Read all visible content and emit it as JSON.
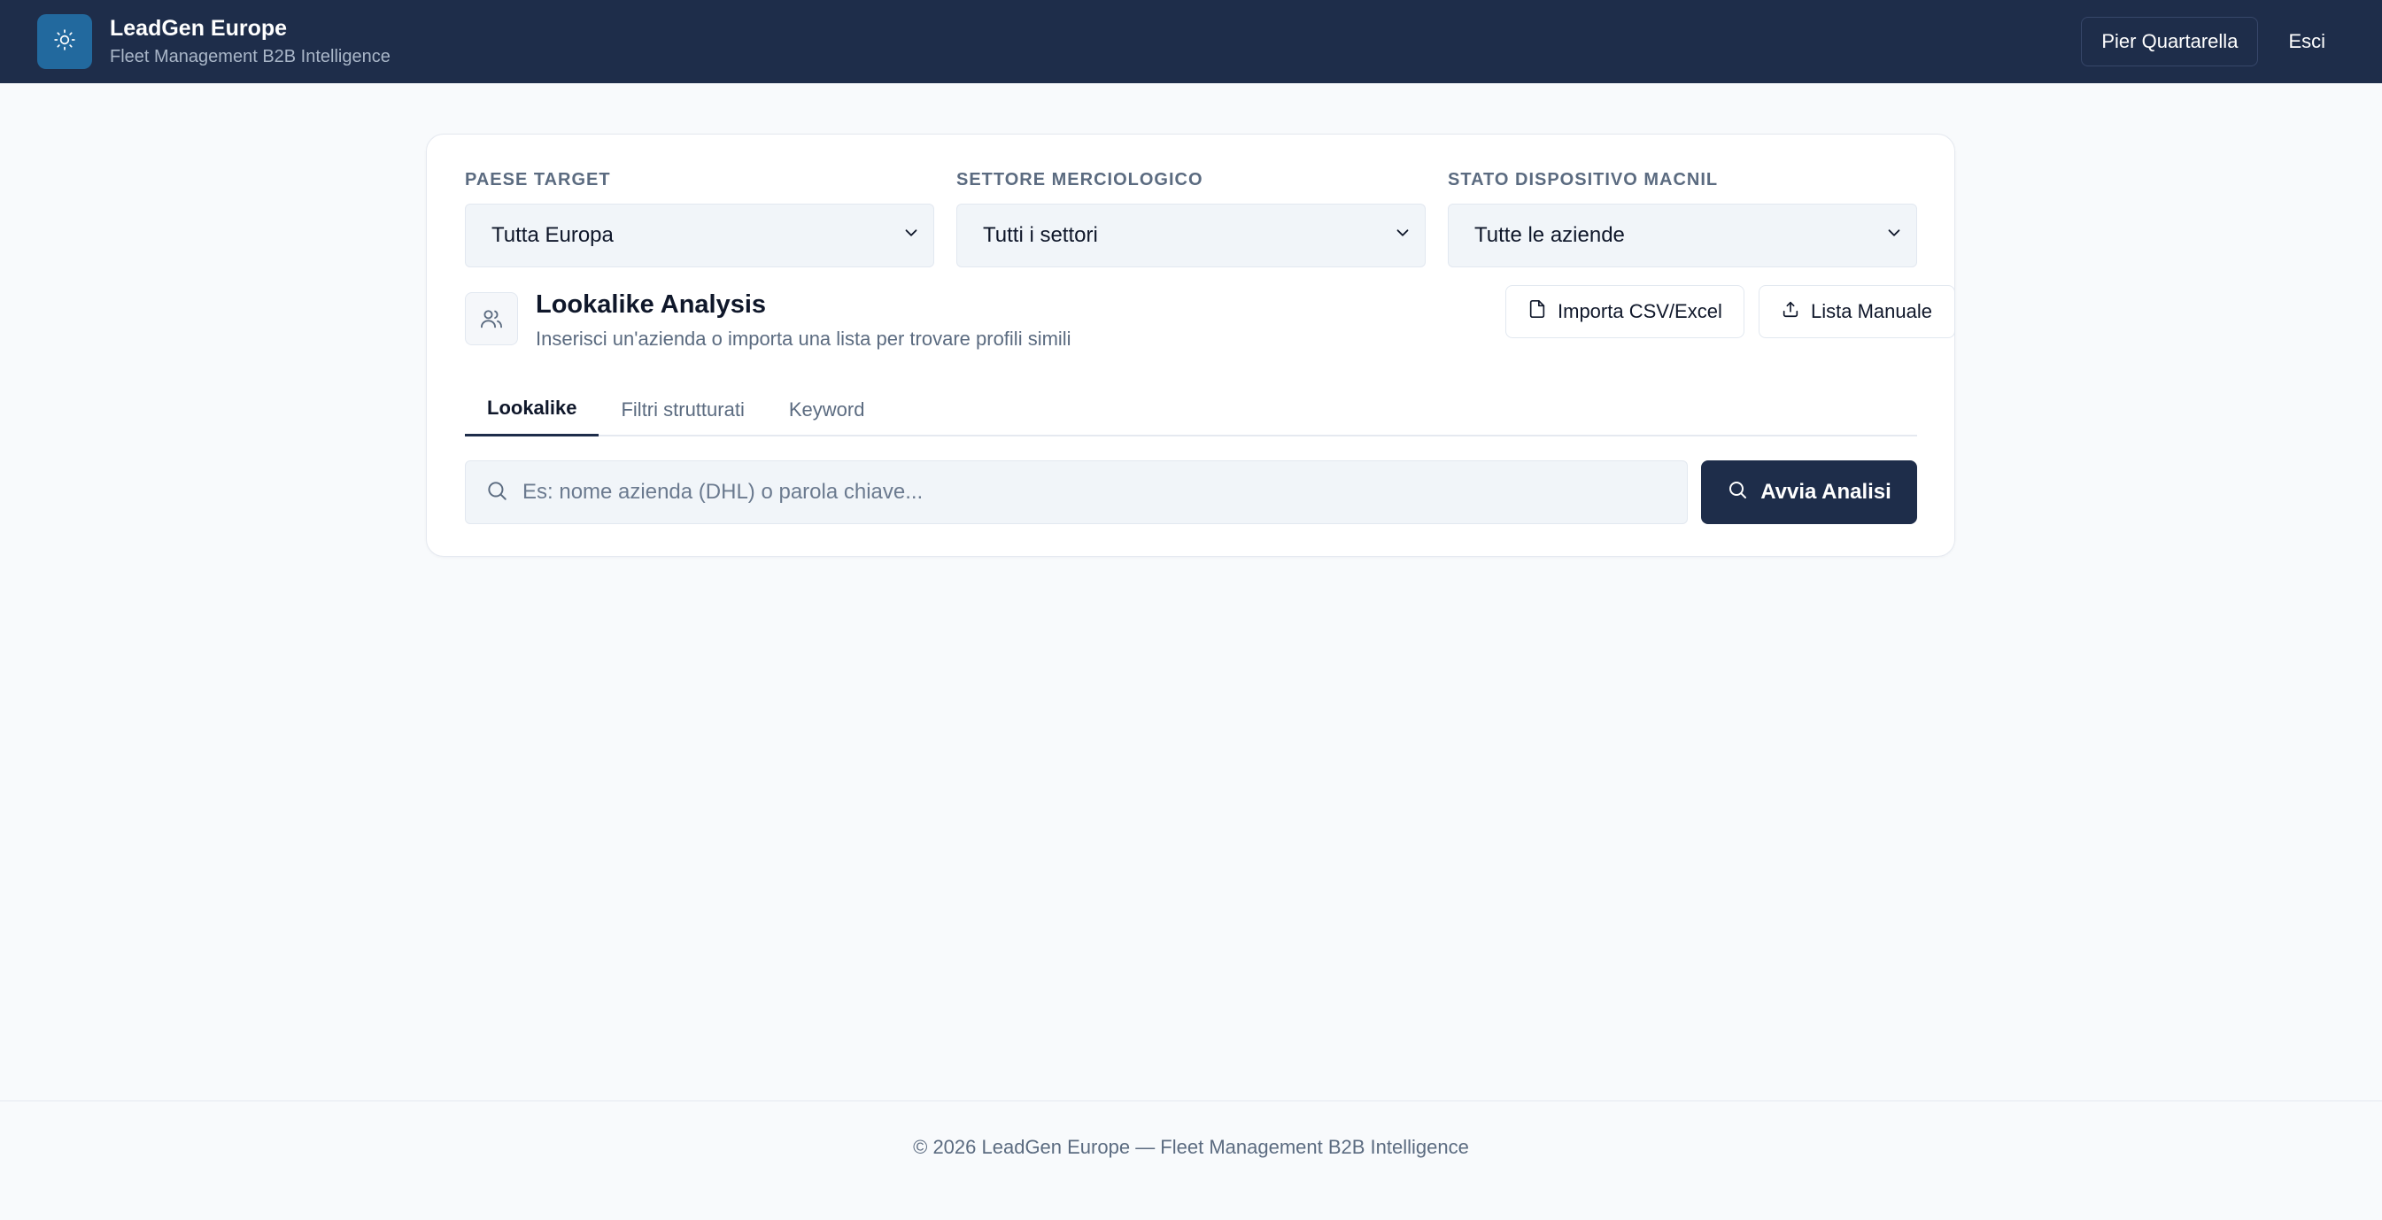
{
  "app": {
    "title": "LeadGen Europe",
    "subtitle": "Fleet Management B2B Intelligence",
    "logo_icon": "sun-icon"
  },
  "header": {
    "user_label": "Pier Quartarella",
    "logout_label": "Esci"
  },
  "filters": [
    {
      "label": "PAESE TARGET",
      "value": "Tutta Europa"
    },
    {
      "label": "SETTORE MERCIOLOGICO",
      "value": "Tutti i settori"
    },
    {
      "label": "STATO DISPOSITIVO MACNIL",
      "value": "Tutte le aziende"
    }
  ],
  "lookalike": {
    "title": "Lookalike Analysis",
    "description": "Inserisci un'azienda o importa una lista per trovare profili simili",
    "icon": "users-icon",
    "import_label": "Importa CSV/Excel",
    "manual_label": "Lista Manuale"
  },
  "tabs": [
    {
      "label": "Lookalike",
      "active": true
    },
    {
      "label": "Filtri strutturati",
      "active": false
    },
    {
      "label": "Keyword",
      "active": false
    }
  ],
  "search": {
    "placeholder": "Es: nome azienda (DHL) o parola chiave...",
    "value": "",
    "submit_label": "Avvia Analisi"
  },
  "footer": {
    "text": "© 2026 LeadGen Europe — Fleet Management B2B Intelligence"
  },
  "colors": {
    "header_bg": "#1e2d4a",
    "logo_bg": "#22699e",
    "page_bg": "#f8fafc",
    "primary": "#1e2d4a",
    "muted_text": "#5b6b80"
  }
}
